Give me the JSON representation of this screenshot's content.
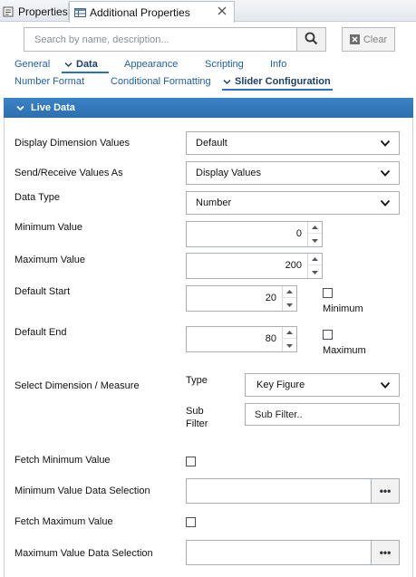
{
  "tabs": {
    "properties": "Properties",
    "additional": "Additional Properties"
  },
  "search": {
    "placeholder": "Search by name, description...",
    "clear_label": "Clear"
  },
  "categories": {
    "row1": [
      "General",
      "Data",
      "Appearance",
      "Scripting",
      "Info"
    ],
    "row2": [
      "Number Format",
      "Conditional Formatting",
      "Slider Configuration"
    ],
    "active_row1": "Data",
    "active_row2": "Slider Configuration"
  },
  "section": {
    "title": "Live Data"
  },
  "form": {
    "display_dimension_values": {
      "label": "Display Dimension Values",
      "value": "Default"
    },
    "send_receive_values_as": {
      "label": "Send/Receive Values As",
      "value": "Display Values"
    },
    "data_type": {
      "label": "Data Type",
      "value": "Number"
    },
    "minimum_value": {
      "label": "Minimum Value",
      "value": "0"
    },
    "maximum_value": {
      "label": "Maximum Value",
      "value": "200"
    },
    "default_start": {
      "label": "Default Start",
      "value": "20",
      "checkbox_label": "Minimum"
    },
    "default_end": {
      "label": "Default End",
      "value": "80",
      "checkbox_label": "Maximum"
    },
    "select_dimension_measure": {
      "label": "Select Dimension / Measure",
      "type_label": "Type",
      "type_value": "Key Figure",
      "sub_filter_label_1": "Sub",
      "sub_filter_label_2": "Filter",
      "sub_filter_placeholder": "Sub Filter.."
    },
    "fetch_minimum_value": {
      "label": "Fetch Minimum Value"
    },
    "minimum_value_data_selection": {
      "label": "Minimum Value Data Selection",
      "button": "•••"
    },
    "fetch_maximum_value": {
      "label": "Fetch Maximum Value"
    },
    "maximum_value_data_selection": {
      "label": "Maximum Value Data Selection",
      "button": "•••"
    }
  },
  "colors": {
    "section_header": "#2f75b8",
    "link": "#1e5fa8",
    "active_underline": "#2a6fc6"
  },
  "icons": {
    "properties_tab": "properties-icon",
    "additional_tab": "table-icon",
    "close": "close-icon",
    "search": "search-icon",
    "clear": "clear-icon",
    "chevron": "chevron-down-icon",
    "more": "ellipsis-icon"
  }
}
